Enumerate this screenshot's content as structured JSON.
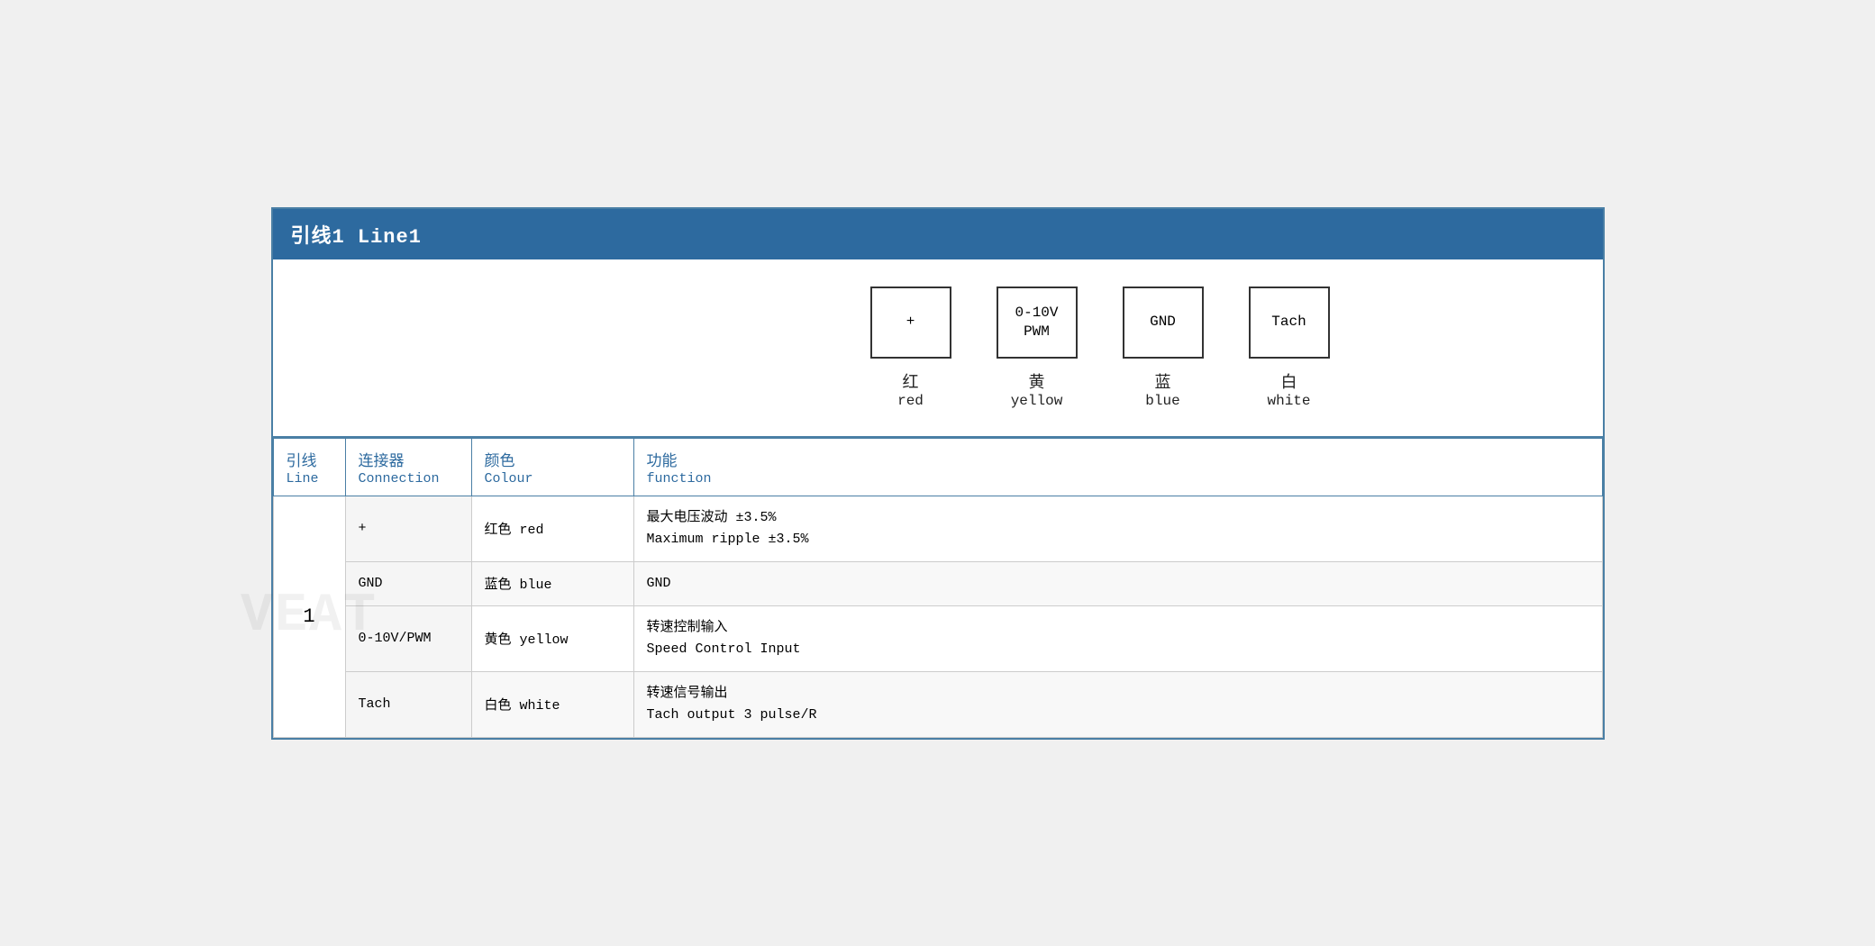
{
  "title": "引线1 Line1",
  "diagram": {
    "connectors": [
      {
        "symbol": "+",
        "label_zh": "红",
        "label_en": "red"
      },
      {
        "symbol": "0-10V\nPWM",
        "label_zh": "黄",
        "label_en": "yellow"
      },
      {
        "symbol": "GND",
        "label_zh": "蓝",
        "label_en": "blue"
      },
      {
        "symbol": "Tach",
        "label_zh": "白",
        "label_en": "white"
      }
    ]
  },
  "table": {
    "headers": {
      "line_zh": "引线",
      "line_en": "Line",
      "conn_zh": "连接器",
      "conn_en": "Connection",
      "color_zh": "颜色",
      "color_en": "Colour",
      "func_zh": "功能",
      "func_en": "function"
    },
    "rows": [
      {
        "line": "1",
        "connection": "+",
        "color": "红色 red",
        "func_zh": "最大电压波动 ±3.5%",
        "func_en": "Maximum ripple ±3.5%"
      },
      {
        "line": "",
        "connection": "GND",
        "color": "蓝色 blue",
        "func_zh": "GND",
        "func_en": ""
      },
      {
        "line": "",
        "connection": "0-10V/PWM",
        "color": "黄色 yellow",
        "func_zh": "转速控制输入",
        "func_en": "Speed Control Input"
      },
      {
        "line": "",
        "connection": "Tach",
        "color": "白色 white",
        "func_zh": "转速信号输出",
        "func_en": "Tach output 3 pulse/R"
      }
    ]
  }
}
